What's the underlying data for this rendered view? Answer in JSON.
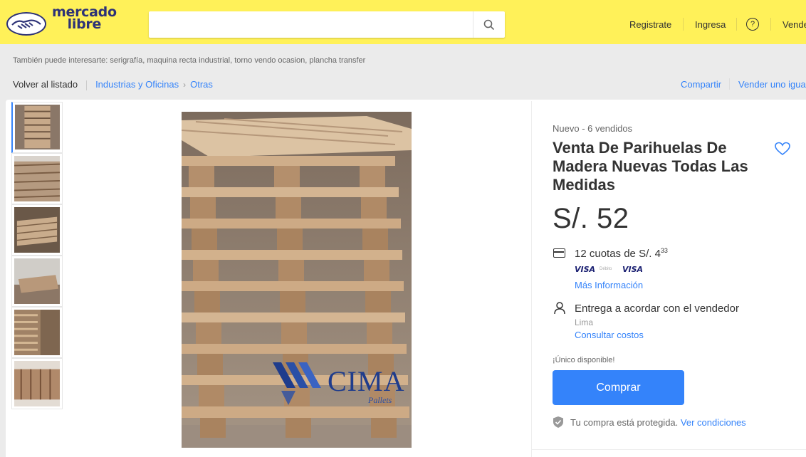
{
  "header": {
    "logo_line1": "mercado",
    "logo_line2": "libre",
    "search_placeholder": "",
    "registrate": "Registrate",
    "ingresa": "Ingresa",
    "help": "?",
    "vender": "Vende"
  },
  "suggestions": "También puede interesarte: serigrafía, maquina recta industrial, torno vendo ocasion, plancha transfer",
  "breadcrumb": {
    "back": "Volver al listado",
    "cat1": "Industrias y Oficinas",
    "arrow": "›",
    "cat2": "Otras"
  },
  "actions": {
    "share": "Compartir",
    "sell_same": "Vender uno igua"
  },
  "gallery": {
    "thumb_count": 6,
    "watermark_brand": "CIMA",
    "watermark_sub": "Pallets"
  },
  "product": {
    "condition": "Nuevo",
    "sold_sep": "-",
    "sold": "6 vendidos",
    "title": "Venta De Parihuelas De Madera Nuevas Todas Las Medidas",
    "price": "S/. 52",
    "cuotas_text": "12 cuotas de S/. 4",
    "cuotas_cents": "33",
    "visa1": "VISA",
    "debito": "Débito",
    "visa2": "VISA",
    "mas_info": "Más Información",
    "entrega": "Entrega a acordar con el vendedor",
    "location": "Lima",
    "consultar": "Consultar costos",
    "unico": "¡Único disponible!",
    "buy": "Comprar",
    "protegida": "Tu compra está protegida.",
    "ver_condiciones": "Ver condiciones"
  },
  "colors": {
    "header_bg": "#fff159",
    "accent_blue": "#3483fa",
    "brand_navy": "#2d3277"
  }
}
